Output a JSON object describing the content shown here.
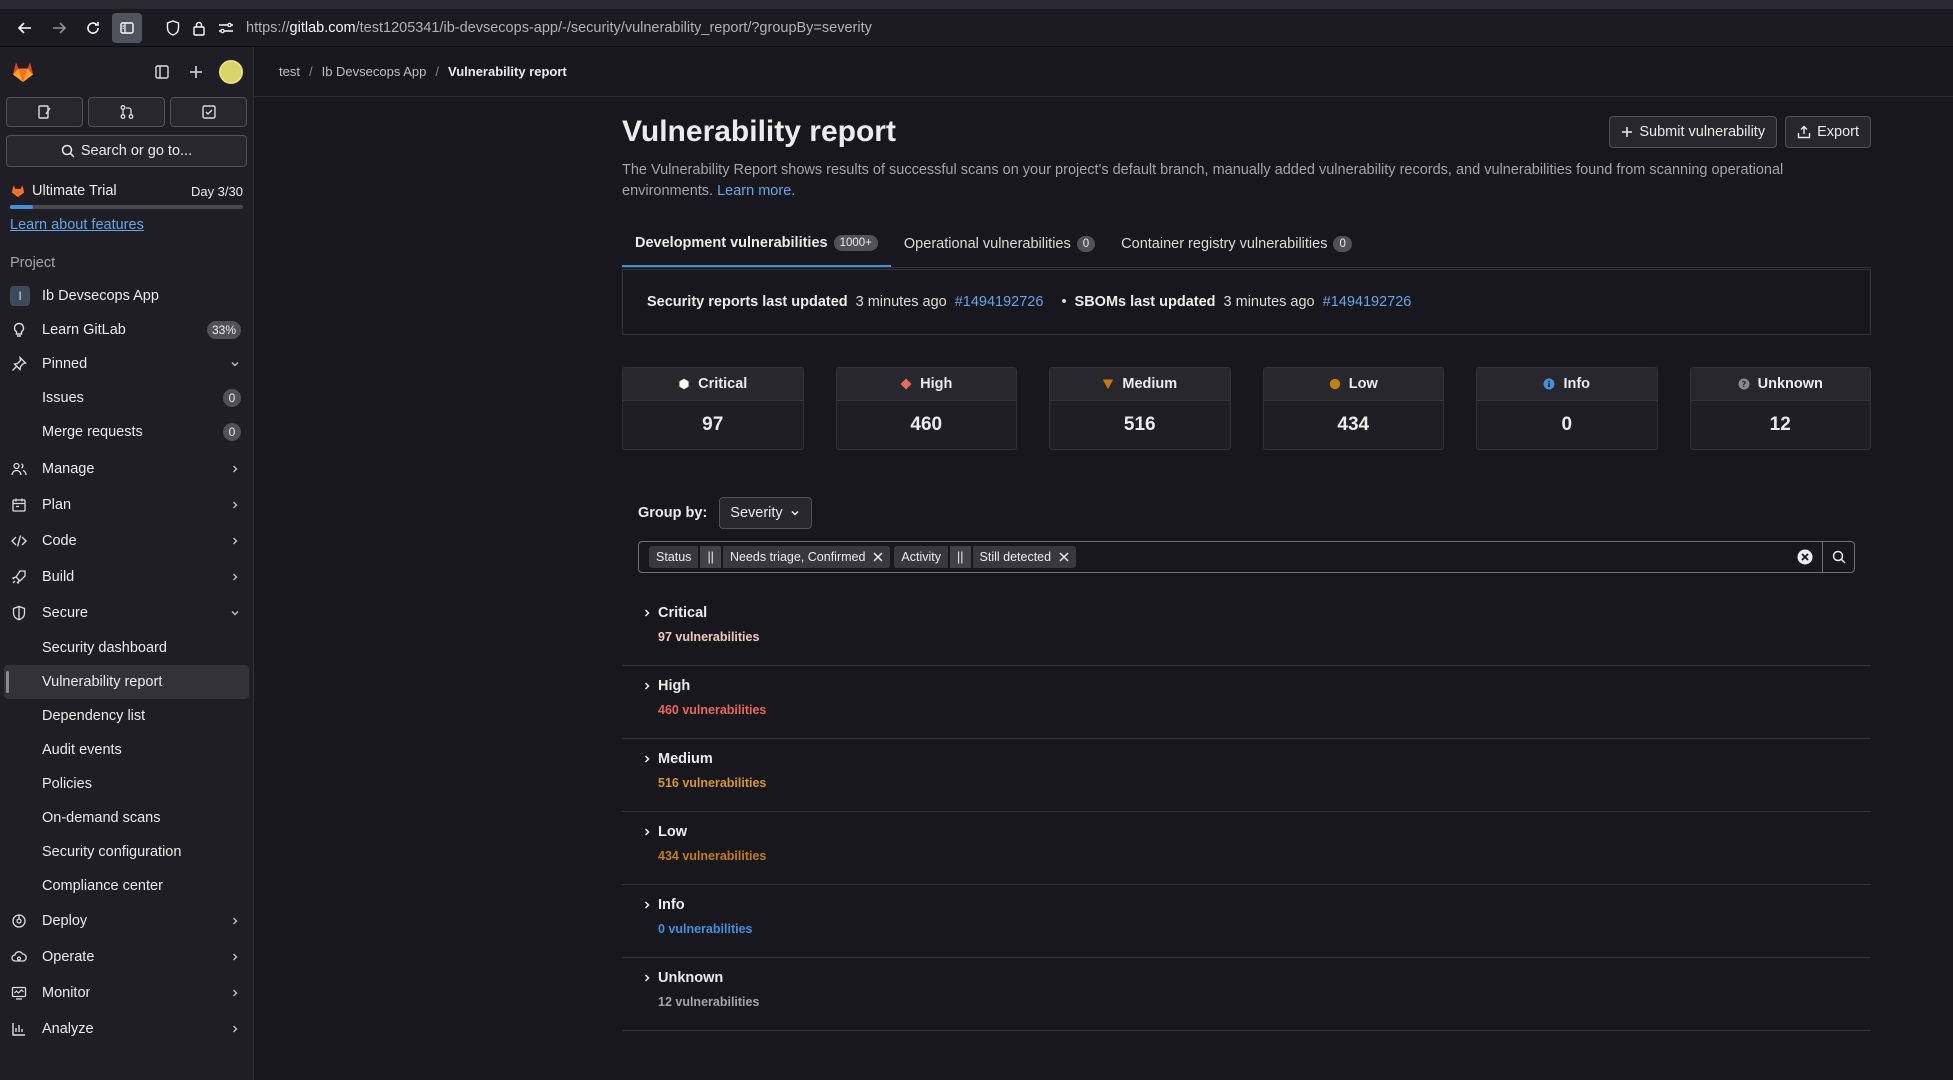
{
  "browser": {
    "url_domain": "gitlab.com",
    "url_prefix": "https://",
    "url_path": "/test1205341/ib-devsecops-app/-/security/vulnerability_report/?groupBy=severity"
  },
  "sidebar": {
    "search_label": "Search or go to...",
    "trial": {
      "label": "Ultimate Trial",
      "day": "Day 3/30",
      "progress": 0.1
    },
    "learn_link": "Learn about features",
    "section_label": "Project",
    "project": {
      "initial": "I",
      "name": "Ib Devsecops App"
    },
    "learn_gitlab": {
      "label": "Learn GitLab",
      "badge": "33%"
    },
    "pinned": {
      "label": "Pinned",
      "items": [
        {
          "label": "Issues",
          "count": "0"
        },
        {
          "label": "Merge requests",
          "count": "0"
        }
      ]
    },
    "groups": {
      "manage": "Manage",
      "plan": "Plan",
      "code": "Code",
      "build": "Build",
      "secure": "Secure",
      "deploy": "Deploy",
      "operate": "Operate",
      "monitor": "Monitor",
      "analyze": "Analyze"
    },
    "secure_items": [
      "Security dashboard",
      "Vulnerability report",
      "Dependency list",
      "Audit events",
      "Policies",
      "On-demand scans",
      "Security configuration",
      "Compliance center"
    ]
  },
  "breadcrumb": {
    "items": [
      "test",
      "Ib Devsecops App"
    ],
    "current": "Vulnerability report"
  },
  "header": {
    "title": "Vulnerability report",
    "submit_label": "Submit vulnerability",
    "export_label": "Export",
    "description": "The Vulnerability Report shows results of successful scans on your project's default branch, manually added vulnerability records, and vulnerabilities found from scanning operational environments.",
    "learn_more": "Learn more."
  },
  "tabs": [
    {
      "label": "Development vulnerabilities",
      "count": "1000+"
    },
    {
      "label": "Operational vulnerabilities",
      "count": "0"
    },
    {
      "label": "Container registry vulnerabilities",
      "count": "0"
    }
  ],
  "updated": {
    "security_label": "Security reports last updated",
    "security_ago": "3 minutes ago",
    "security_pipeline": "#1494192726",
    "sbom_label": "SBOMs last updated",
    "sbom_ago": "3 minutes ago",
    "sbom_pipeline": "#1494192726"
  },
  "severity_cards": [
    {
      "label": "Critical",
      "count": "97",
      "icon": "critical-icon",
      "color": "#f5f5f5"
    },
    {
      "label": "High",
      "count": "460",
      "icon": "high-icon",
      "color": "#e9675a"
    },
    {
      "label": "Medium",
      "count": "516",
      "icon": "medium-icon",
      "color": "#c17d10"
    },
    {
      "label": "Low",
      "count": "434",
      "icon": "low-icon",
      "color": "#c17d10"
    },
    {
      "label": "Info",
      "count": "0",
      "icon": "info-icon",
      "color": "#428fdc"
    },
    {
      "label": "Unknown",
      "count": "12",
      "icon": "unknown-icon",
      "color": "#89888d"
    }
  ],
  "group_by": {
    "label": "Group by:",
    "value": "Severity"
  },
  "filters": {
    "status_key": "Status",
    "status_op": "||",
    "status_value": "Needs triage, Confirmed",
    "activity_key": "Activity",
    "activity_op": "||",
    "activity_value": "Still detected"
  },
  "groups": [
    {
      "label": "Critical",
      "count": "97 vulnerabilities",
      "color": "#f2c6c1"
    },
    {
      "label": "High",
      "count": "460 vulnerabilities",
      "color": "#e9675a"
    },
    {
      "label": "Medium",
      "count": "516 vulnerabilities",
      "color": "#d99530"
    },
    {
      "label": "Low",
      "count": "434 vulnerabilities",
      "color": "#c17d10"
    },
    {
      "label": "Info",
      "count": "0 vulnerabilities",
      "color": "#428fdc"
    },
    {
      "label": "Unknown",
      "count": "12 vulnerabilities",
      "color": "#a4a3a8"
    }
  ]
}
